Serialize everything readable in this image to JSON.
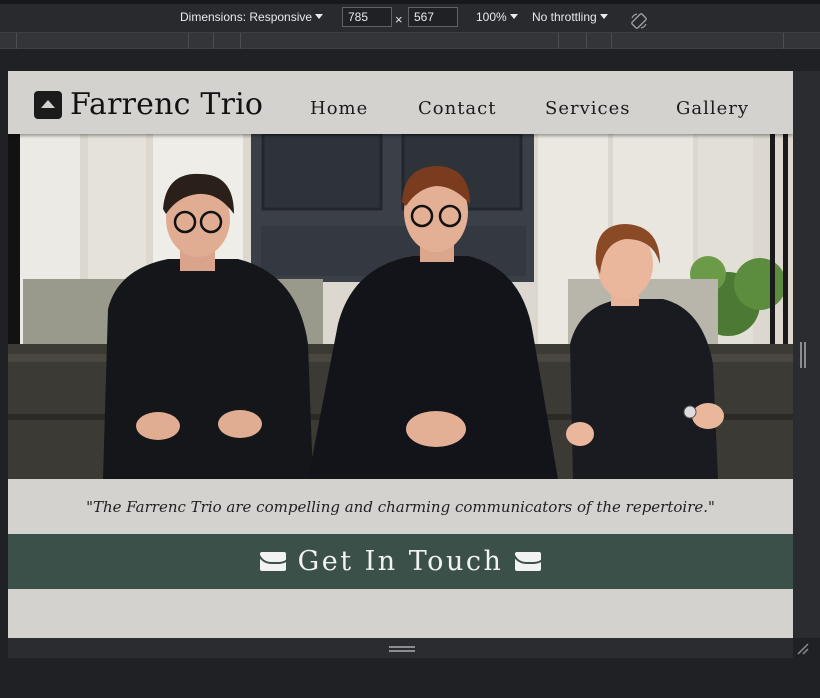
{
  "devtools": {
    "dimensions_label": "Dimensions: Responsive",
    "width_value": "785",
    "times": "×",
    "height_value": "567",
    "zoom": "100%",
    "throttling": "No throttling",
    "rotate_icon": "rotate-icon"
  },
  "site": {
    "brand_name": "Farrenc Trio",
    "nav": [
      "Home",
      "Contact",
      "Services",
      "Gallery"
    ],
    "hero_image": "three musicians seated on steps",
    "quote": "\"The Farrenc Trio are compelling and charming communicators of the repertoire.\"",
    "cta_label": "Get In Touch",
    "colors": {
      "page_bg": "#d4d2ce",
      "cta_bg": "#3a5048",
      "cta_text": "#f2f2f2",
      "devtools_bg": "#292a2d"
    }
  }
}
